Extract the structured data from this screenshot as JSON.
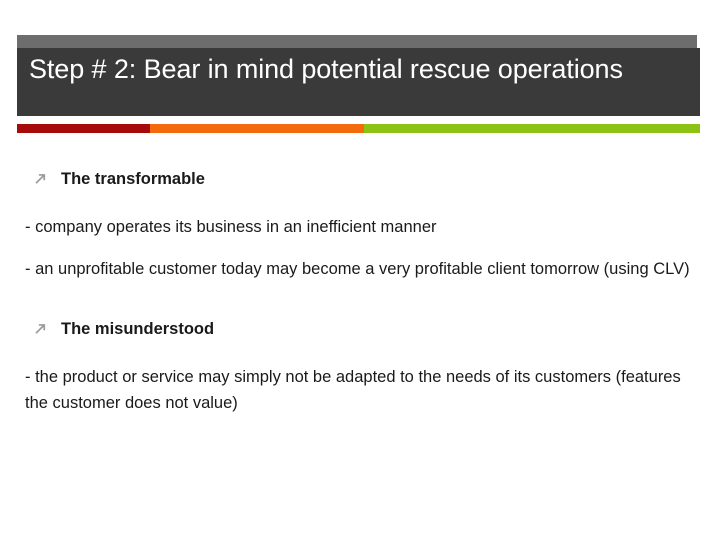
{
  "slide": {
    "title": "Step # 2: Bear in mind potential rescue operations",
    "accent_colors": {
      "dark_red": "#a50b0b",
      "orange": "#f36b0d",
      "green": "#8cc213",
      "title_bar_dark": "#3a3a3a",
      "title_bar_light": "#6d6d6d"
    },
    "bullets": [
      {
        "icon": "arrow-up-right-icon",
        "label": "The transformable",
        "paragraphs": [
          "- company operates its business in an inefficient manner",
          "- an unprofitable customer today may become a very profitable client tomorrow (using CLV)"
        ]
      },
      {
        "icon": "arrow-up-right-icon",
        "label": "The misunderstood",
        "paragraphs": [
          "- the product or service may simply not be adapted to the needs of its customers (features the customer does not value)"
        ]
      }
    ]
  }
}
